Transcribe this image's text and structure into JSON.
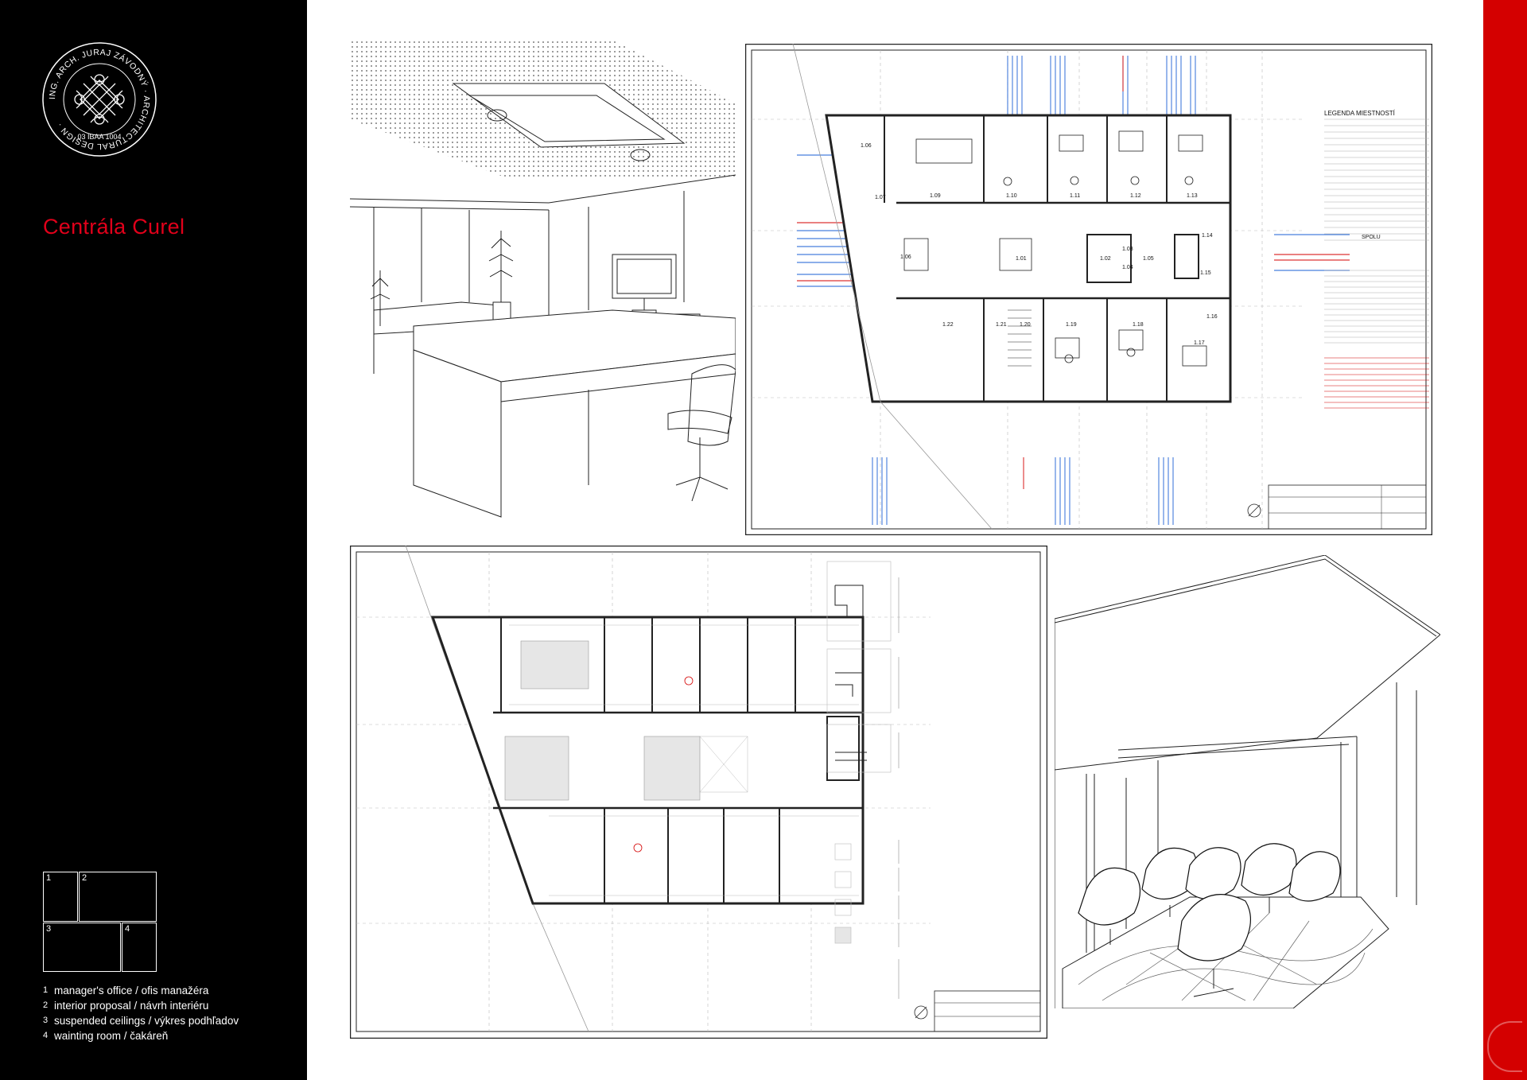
{
  "logo": {
    "ring_text": "ING. ARCH. JURAJ ZÁVODNÝ · ARCHITECTURAL DESIGN ·",
    "registration": "03 IBAA 1004"
  },
  "project": {
    "title": "Centrála Curel"
  },
  "key_numbers": [
    "1",
    "2",
    "3",
    "4"
  ],
  "legend": [
    {
      "num": "1",
      "text": "manager's office / ofis manažéra"
    },
    {
      "num": "2",
      "text": "interior proposal / návrh interiéru"
    },
    {
      "num": "3",
      "text": "suspended ceilings / výkres podhľadov"
    },
    {
      "num": "4",
      "text": "wainting room / čakáreň"
    }
  ],
  "plan": {
    "legend_title": "LEGENDA MIESTNOSTÍ",
    "rooms": [
      "1.01",
      "1.02",
      "1.03",
      "1.04",
      "1.05",
      "1.06",
      "1.07",
      "1.09",
      "1.10",
      "1.11",
      "1.12",
      "1.13",
      "1.14",
      "1.15",
      "1.16",
      "1.17",
      "1.18",
      "1.19",
      "1.20",
      "1.21",
      "1.22"
    ],
    "total_label": "SPOLU"
  },
  "colors": {
    "sidebar": "#000000",
    "accent_red": "#d40000",
    "title_red": "#e0001a",
    "annotation_blue": "#1a5fd6"
  }
}
